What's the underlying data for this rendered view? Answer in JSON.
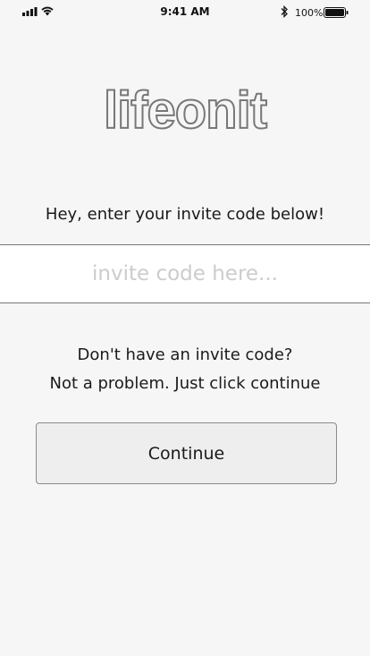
{
  "status_bar": {
    "time": "9:41 AM",
    "battery_percent": "100%",
    "icons": [
      "signal-icon",
      "wifi-icon",
      "bluetooth-icon",
      "battery-icon"
    ]
  },
  "logo": {
    "text": "lifeonit"
  },
  "prompt": {
    "text": "Hey, enter your invite code below!"
  },
  "invite_code": {
    "value": "",
    "placeholder": "invite code here..."
  },
  "no_code": {
    "line1": "Don't have an invite code?",
    "line2": "Not a problem. Just click continue"
  },
  "continue_button": {
    "label": "Continue"
  },
  "colors": {
    "background": "#f6f6f6",
    "field_background": "#ffffff",
    "button_background": "#eeeeee",
    "border": "#777777",
    "placeholder": "#cccccc",
    "logo_outline": "#777777"
  }
}
